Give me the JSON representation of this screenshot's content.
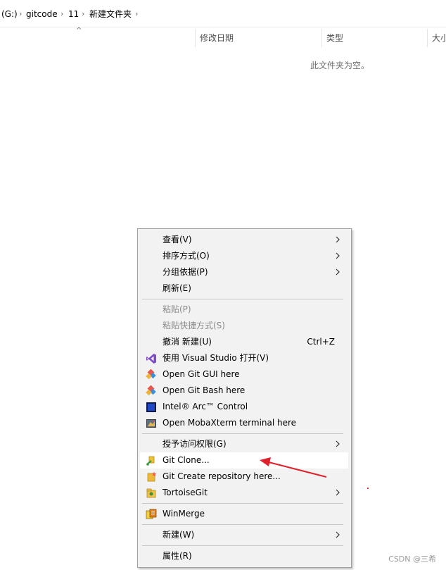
{
  "breadcrumb": {
    "drive": "(G:)",
    "parts": [
      "gitcode",
      "11",
      "新建文件夹"
    ],
    "separator": "›"
  },
  "columns": {
    "sort_caret": "^",
    "modified": "修改日期",
    "type": "类型",
    "size": "大小"
  },
  "empty_message": "此文件夹为空。",
  "menu": {
    "view": "查看(V)",
    "sort_by": "排序方式(O)",
    "group_by": "分组依据(P)",
    "refresh": "刷新(E)",
    "paste": "粘贴(P)",
    "paste_shortcut": "粘贴快捷方式(S)",
    "undo": "撤消 新建(U)",
    "undo_shortcut": "Ctrl+Z",
    "open_vs": "使用 Visual Studio 打开(V)",
    "git_gui": "Open Git GUI here",
    "git_bash": "Open Git Bash here",
    "intel_arc": "Intel® Arc™ Control",
    "mobaxterm": "Open MobaXterm terminal here",
    "give_access": "授予访问权限(G)",
    "git_clone": "Git Clone...",
    "git_create_repo": "Git Create repository here...",
    "tortoisegit": "TortoiseGit",
    "winmerge": "WinMerge",
    "new": "新建(W)",
    "properties": "属性(R)"
  },
  "colors": {
    "menu_bg": "#f2f2f2",
    "highlight_bg": "#ffffff",
    "disabled_text": "#8a8a8a",
    "annotation_arrow": "#e0202a"
  },
  "watermark": "CSDN @三希"
}
